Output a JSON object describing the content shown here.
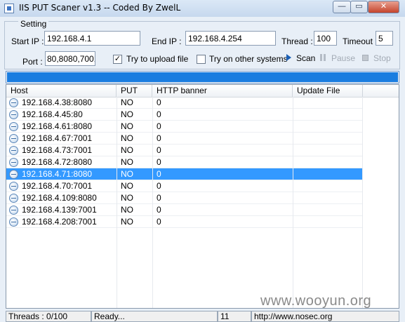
{
  "window": {
    "title": "IIS PUT Scaner v1.3 -- Coded By ZwelL",
    "minimize_glyph": "—",
    "maximize_glyph": "▭",
    "close_glyph": "✕"
  },
  "settings": {
    "group_label": "Setting",
    "start_ip_label": "Start IP :",
    "start_ip_value": "192.168.4.1",
    "end_ip_label": "End IP :",
    "end_ip_value": "192.168.4.254",
    "thread_label": "Thread :",
    "thread_value": "100",
    "timeout_label": "Timeout :",
    "timeout_value": "5",
    "port_label": "Port :",
    "port_value": "80,8080,7001",
    "upload_label": "Try to upload file",
    "upload_checked": true,
    "upload_mark": "✓",
    "other_systems_label": "Try on other systems",
    "other_systems_checked": false,
    "scan_label": "Scan",
    "pause_label": "Pause",
    "stop_label": "Stop"
  },
  "progress": {
    "value": 1.0
  },
  "table": {
    "columns": [
      "Host",
      "PUT",
      "HTTP banner",
      "Update File"
    ],
    "rows": [
      {
        "host": "192.168.4.38:8080",
        "put": "NO",
        "banner": "0",
        "update": "",
        "selected": false
      },
      {
        "host": "192.168.4.45:80",
        "put": "NO",
        "banner": "0",
        "update": "",
        "selected": false
      },
      {
        "host": "192.168.4.61:8080",
        "put": "NO",
        "banner": "0",
        "update": "",
        "selected": false
      },
      {
        "host": "192.168.4.67:7001",
        "put": "NO",
        "banner": "0",
        "update": "",
        "selected": false
      },
      {
        "host": "192.168.4.73:7001",
        "put": "NO",
        "banner": "0",
        "update": "",
        "selected": false
      },
      {
        "host": "192.168.4.72:8080",
        "put": "NO",
        "banner": "0",
        "update": "",
        "selected": false
      },
      {
        "host": "192.168.4.71:8080",
        "put": "NO",
        "banner": "0",
        "update": "",
        "selected": true
      },
      {
        "host": "192.168.4.70:7001",
        "put": "NO",
        "banner": "0",
        "update": "",
        "selected": false
      },
      {
        "host": "192.168.4.109:8080",
        "put": "NO",
        "banner": "0",
        "update": "",
        "selected": false
      },
      {
        "host": "192.168.4.139:7001",
        "put": "NO",
        "banner": "0",
        "update": "",
        "selected": false
      },
      {
        "host": "192.168.4.208:7001",
        "put": "NO",
        "banner": "0",
        "update": "",
        "selected": false
      }
    ]
  },
  "statusbar": {
    "threads": "Threads : 0/100",
    "state": "Ready...",
    "count": "11",
    "url": "http://www.nosec.org"
  },
  "watermark": "www.wooyun.org",
  "colors": {
    "progress_fill": "#1a7de0",
    "selection": "#3399ff"
  }
}
